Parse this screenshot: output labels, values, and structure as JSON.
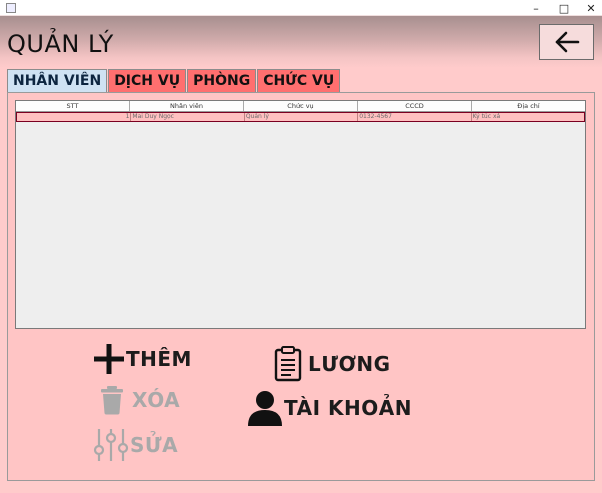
{
  "window": {
    "min_icon": "minimize-icon",
    "max_icon": "maximize-icon",
    "close_icon": "close-icon"
  },
  "header": {
    "title": "QUẢN LÝ",
    "back_icon": "arrow-left-icon"
  },
  "tabs": [
    {
      "label": "NHÂN VIÊN",
      "active": true
    },
    {
      "label": "DỊCH VỤ",
      "active": false
    },
    {
      "label": "PHÒNG",
      "active": false
    },
    {
      "label": "CHỨC VỤ",
      "active": false
    }
  ],
  "table": {
    "columns": [
      "STT",
      "Nhân viên",
      "Chức vụ",
      "CCCD",
      "Địa chỉ"
    ],
    "rows": [
      [
        "1",
        "Mai Duy Ngọc",
        "Quản lý",
        "0132-4567",
        "Ký túc xá"
      ]
    ]
  },
  "actions": {
    "add": {
      "label": "THÊM",
      "icon": "plus-icon"
    },
    "delete": {
      "label": "XÓA",
      "icon": "trash-icon"
    },
    "edit": {
      "label": "SỬA",
      "icon": "sliders-icon"
    },
    "salary": {
      "label": "LƯƠNG",
      "icon": "clipboard-icon"
    },
    "account": {
      "label": "TÀI KHOẢN",
      "icon": "user-icon"
    }
  },
  "colors": {
    "background": "#ffcbcb",
    "tab_inactive": "#ff6f6f",
    "tab_active": "#cfe2f3",
    "muted": "#a9a9a9"
  }
}
